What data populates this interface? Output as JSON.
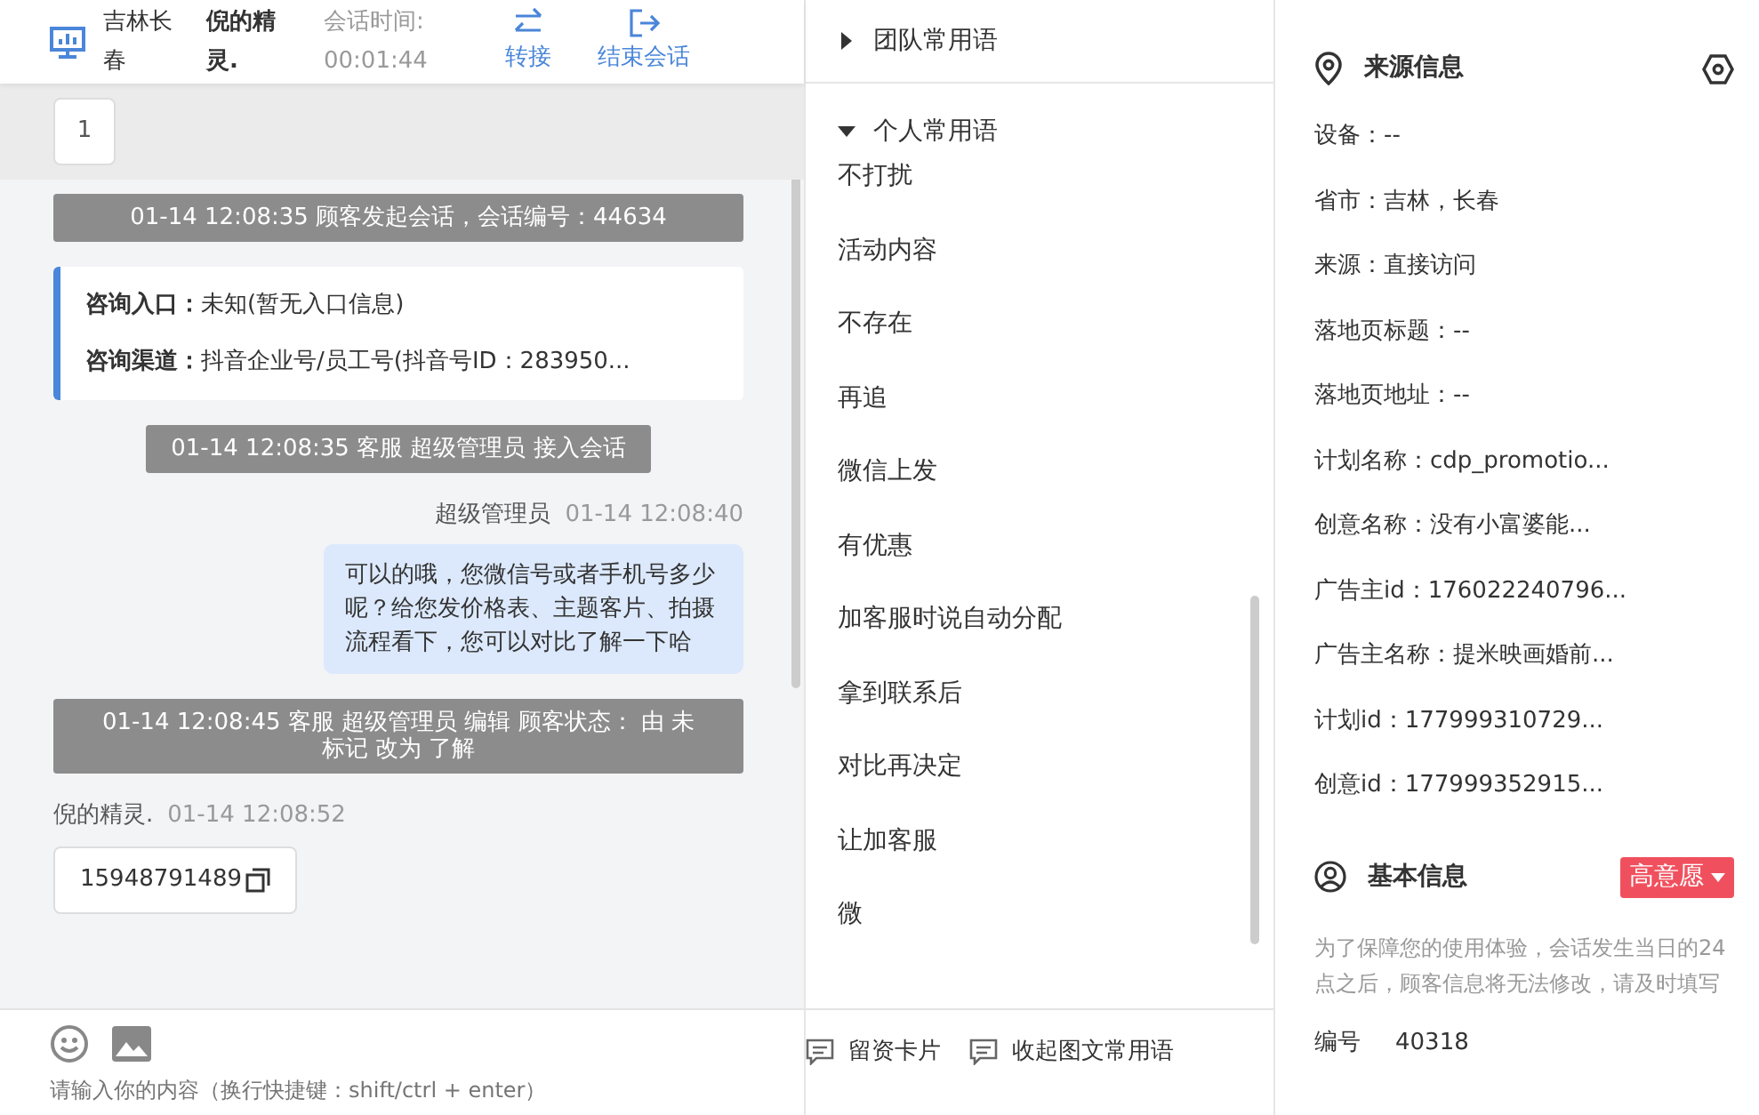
{
  "header": {
    "customer_location": "吉林长春",
    "customer_name": "倪的精灵.",
    "timer_label": "会话时间:",
    "timer": "00:01:44",
    "actions": [
      {
        "kind": "transfer",
        "label": "转接"
      },
      {
        "kind": "end",
        "label": "结束会话"
      }
    ]
  },
  "pinned": {
    "label": "1"
  },
  "messages": [
    {
      "kind": "system",
      "text": "01-14 12:08:35 顾客发起会话，会话编号：44634"
    },
    {
      "kind": "entry_card",
      "fields": [
        {
          "label": "咨询入口：",
          "value": "未知(暂无入口信息)"
        },
        {
          "label": "咨询渠道：",
          "value": "抖音企业号/员工号(抖音号ID：283950..."
        }
      ]
    },
    {
      "kind": "system",
      "text": "01-14 12:08:35 客服 超级管理员 接入会话"
    },
    {
      "kind": "agent",
      "sender": "超级管理员",
      "time": "01-14 12:08:40",
      "text": "可以的哦，您微信号或者手机号多少呢？给您发价格表、主题客片、拍摄流程看下，您可以对比了解一下哈"
    },
    {
      "kind": "system",
      "text": "01-14 12:08:45 客服 超级管理员 编辑 顾客状态： 由 未标记 改为 了解"
    },
    {
      "kind": "customer",
      "sender": "倪的精灵.",
      "time": "01-14 12:08:52",
      "text": "15948791489"
    }
  ],
  "composer": {
    "placeholder": "请输入你的内容（换行快捷键：shift/ctrl + enter）"
  },
  "phrases": {
    "groups": [
      {
        "label": "团队常用语",
        "expanded": false
      },
      {
        "label": "个人常用语",
        "expanded": true,
        "items": [
          "不打扰",
          "活动内容",
          "不存在",
          "再追",
          "微信上发",
          "有优惠",
          "加客服时说自动分配",
          "拿到联系后",
          "对比再决定",
          "让加客服",
          "微"
        ]
      }
    ],
    "actions": [
      {
        "label": "留资卡片"
      },
      {
        "label": "收起图文常用语"
      }
    ]
  },
  "source_info": {
    "title": "来源信息",
    "fields": [
      "设备：--",
      "省市：吉林，长春",
      "来源：直接访问",
      "落地页标题：--",
      "落地页地址：--",
      "计划名称：cdp_promotio...",
      "创意名称：没有小富婆能...",
      "广告主id：176022240796...",
      "广告主名称：提米映画婚前...",
      "计划id：177999310729...",
      "创意id：177999352915..."
    ]
  },
  "basic_info": {
    "title": "基本信息",
    "intent_tag": "高意愿",
    "notice": "为了保障您的使用体验，会话发生当日的24点之后，顾客信息将无法修改，请及时填写",
    "fields": [
      {
        "label": "编号",
        "value": "40318"
      }
    ]
  }
}
